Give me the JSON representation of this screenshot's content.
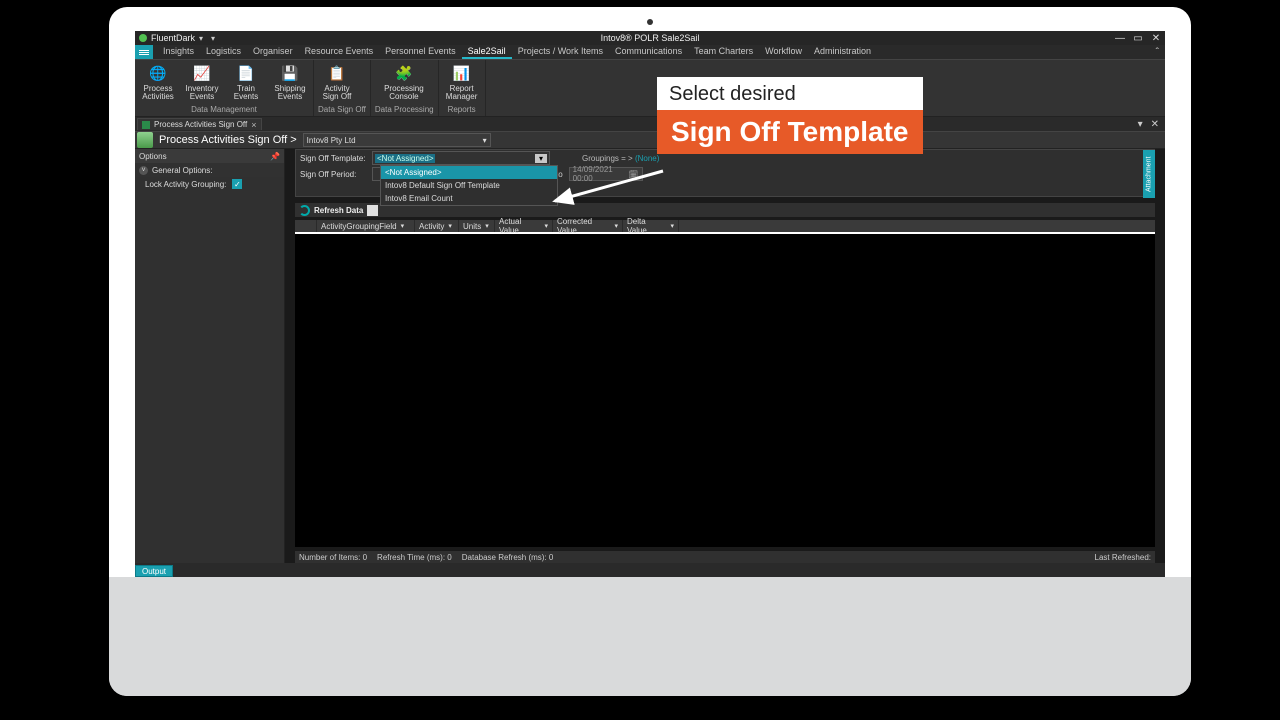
{
  "title_bar": {
    "brand": "FluentDark",
    "title": "Intov8® POLR Sale2Sail"
  },
  "win_buttons": {
    "min": "—",
    "max": "▭",
    "close": "✕"
  },
  "tabs": [
    "Insights",
    "Logistics",
    "Organiser",
    "Resource Events",
    "Personnel Events",
    "Sale2Sail",
    "Projects / Work Items",
    "Communications",
    "Team Charters",
    "Workflow",
    "Administration"
  ],
  "active_tab_index": 5,
  "ribbon": {
    "groups": [
      {
        "title": "Data Management",
        "items": [
          {
            "label": "Process Activities",
            "icon": "🌐"
          },
          {
            "label": "Inventory Events",
            "icon": "📈"
          },
          {
            "label": "Train Events",
            "icon": "📄"
          },
          {
            "label": "Shipping Events",
            "icon": "💾"
          }
        ]
      },
      {
        "title": "Data Sign Off",
        "items": [
          {
            "label": "Activity Sign Off",
            "icon": "📋"
          }
        ]
      },
      {
        "title": "Data Processing",
        "items": [
          {
            "label": "Processing Console",
            "icon": "🧩"
          }
        ]
      },
      {
        "title": "Reports",
        "items": [
          {
            "label": "Report Manager",
            "icon": "📊"
          }
        ]
      }
    ]
  },
  "doc_tab": {
    "label": "Process Activities Sign Off",
    "close": "×"
  },
  "breadcrumb": {
    "title": "Process Activities Sign Off >"
  },
  "company_select": {
    "value": "Intov8 Pty Ltd"
  },
  "sidebar": {
    "options_header": "Options",
    "general_header": "General Options:",
    "lock_label": "Lock Activity Grouping:",
    "lock_checked": true
  },
  "params": {
    "template_label": "Sign Off Template:",
    "template_value": "<Not Assigned>",
    "period_label": "Sign Off Period:",
    "to_label": "to",
    "date_to": "14/09/2021 00:00",
    "groupings_label": "Groupings = >",
    "groupings_value": "(None)"
  },
  "template_dropdown": {
    "options": [
      "<Not Assigned>",
      "Intov8 Default Sign Off Template",
      "Intov8 Email Count"
    ],
    "highlighted": 0
  },
  "refresh": {
    "label": "Refresh Data"
  },
  "columns": [
    "ActivityGroupingField",
    "Activity",
    "Units",
    "Actual Value",
    "Corrected Value",
    "Delta Value"
  ],
  "status": {
    "items_label": "Number of Items:",
    "items_value": "0",
    "refresh_label": "Refresh Time (ms):",
    "refresh_value": "0",
    "db_label": "Database Refresh (ms):",
    "db_value": "0",
    "last_label": "Last Refreshed:"
  },
  "output_tab": "Output",
  "attach_tab": "Attachment",
  "callout": {
    "line1": "Select desired",
    "line2": "Sign Off Template"
  }
}
